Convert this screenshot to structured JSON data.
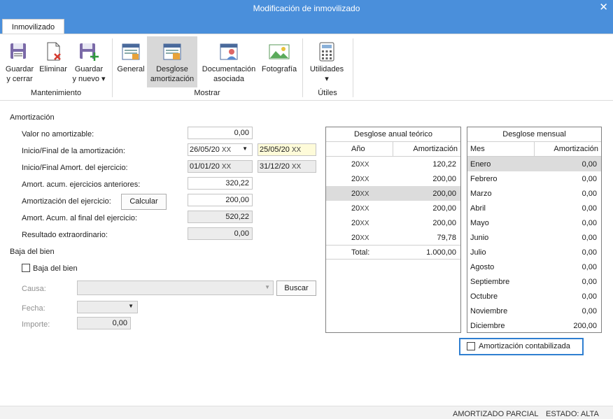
{
  "window": {
    "title": "Modificación de inmovilizado"
  },
  "tabs": [
    {
      "label": "Inmovilizado"
    }
  ],
  "ribbon": {
    "groups": [
      {
        "label": "Mantenimiento",
        "buttons": [
          {
            "line1": "Guardar",
            "line2": "y cerrar",
            "icon": "save-close-icon"
          },
          {
            "line1": "Eliminar",
            "line2": "",
            "icon": "delete-icon"
          },
          {
            "line1": "Guardar",
            "line2": "y nuevo ▾",
            "icon": "save-new-icon"
          }
        ]
      },
      {
        "label": "Mostrar",
        "buttons": [
          {
            "line1": "General",
            "line2": "",
            "icon": "general-icon"
          },
          {
            "line1": "Desglose",
            "line2": "amortización",
            "icon": "desglose-icon",
            "selected": true
          },
          {
            "line1": "Documentación",
            "line2": "asociada",
            "icon": "documentacion-icon"
          },
          {
            "line1": "Fotografía",
            "line2": "",
            "icon": "photo-icon"
          }
        ]
      },
      {
        "label": "Útiles",
        "buttons": [
          {
            "line1": "Utilidades",
            "line2": "▾",
            "icon": "calculator-icon"
          }
        ]
      }
    ]
  },
  "amortizacion": {
    "section_title": "Amortización",
    "valor_no_amortizable": {
      "label": "Valor no amortizable:",
      "value": "0,00"
    },
    "inicio_final": {
      "label": "Inicio/Final de la amortización:",
      "start": "26/05/20",
      "start_suffix": "XX",
      "end": "25/05/20",
      "end_suffix": "XX"
    },
    "inicio_final_ejercicio": {
      "label": "Inicio/Final Amort. del ejercicio:",
      "start": "01/01/20",
      "start_suffix": "XX",
      "end": "31/12/20",
      "end_suffix": "XX"
    },
    "acum_anteriores": {
      "label": "Amort. acum. ejercicios anteriores:",
      "value": "320,22"
    },
    "ejercicio": {
      "label": "Amortización del ejercicio:",
      "value": "200,00",
      "button": "Calcular"
    },
    "acum_final": {
      "label": "Amort. Acum. al final del ejercicio:",
      "value": "520,22"
    },
    "resultado_extra": {
      "label": "Resultado extraordinario:",
      "value": "0,00"
    }
  },
  "baja": {
    "section_title": "Baja del bien",
    "checkbox_label": "Baja del bien",
    "causa_label": "Causa:",
    "buscar_button": "Buscar",
    "fecha_label": "Fecha:",
    "importe_label": "Importe:",
    "importe_value": "0,00"
  },
  "desglose_anual": {
    "title": "Desglose anual teórico",
    "col_year": "Año",
    "col_amount": "Amortización",
    "rows": [
      {
        "year": "20",
        "suffix": "XX",
        "amount": "120,22"
      },
      {
        "year": "20",
        "suffix": "XX",
        "amount": "200,00"
      },
      {
        "year": "20",
        "suffix": "XX",
        "amount": "200,00"
      },
      {
        "year": "20",
        "suffix": "XX",
        "amount": "200,00"
      },
      {
        "year": "20",
        "suffix": "XX",
        "amount": "200,00"
      },
      {
        "year": "20",
        "suffix": "XX",
        "amount": "79,78"
      }
    ],
    "total_label": "Total:",
    "total_value": "1.000,00"
  },
  "desglose_mensual": {
    "title": "Desglose mensual",
    "col_month": "Mes",
    "col_amount": "Amortización",
    "rows": [
      {
        "month": "Enero",
        "amount": "0,00"
      },
      {
        "month": "Febrero",
        "amount": "0,00"
      },
      {
        "month": "Marzo",
        "amount": "0,00"
      },
      {
        "month": "Abril",
        "amount": "0,00"
      },
      {
        "month": "Mayo",
        "amount": "0,00"
      },
      {
        "month": "Junio",
        "amount": "0,00"
      },
      {
        "month": "Julio",
        "amount": "0,00"
      },
      {
        "month": "Agosto",
        "amount": "0,00"
      },
      {
        "month": "Septiembre",
        "amount": "0,00"
      },
      {
        "month": "Octubre",
        "amount": "0,00"
      },
      {
        "month": "Noviembre",
        "amount": "0,00"
      },
      {
        "month": "Diciembre",
        "amount": "200,00"
      }
    ]
  },
  "contabilizada": {
    "label": "Amortización contabilizada"
  },
  "status": {
    "left": "AMORTIZADO PARCIAL",
    "right": "ESTADO: ALTA"
  }
}
